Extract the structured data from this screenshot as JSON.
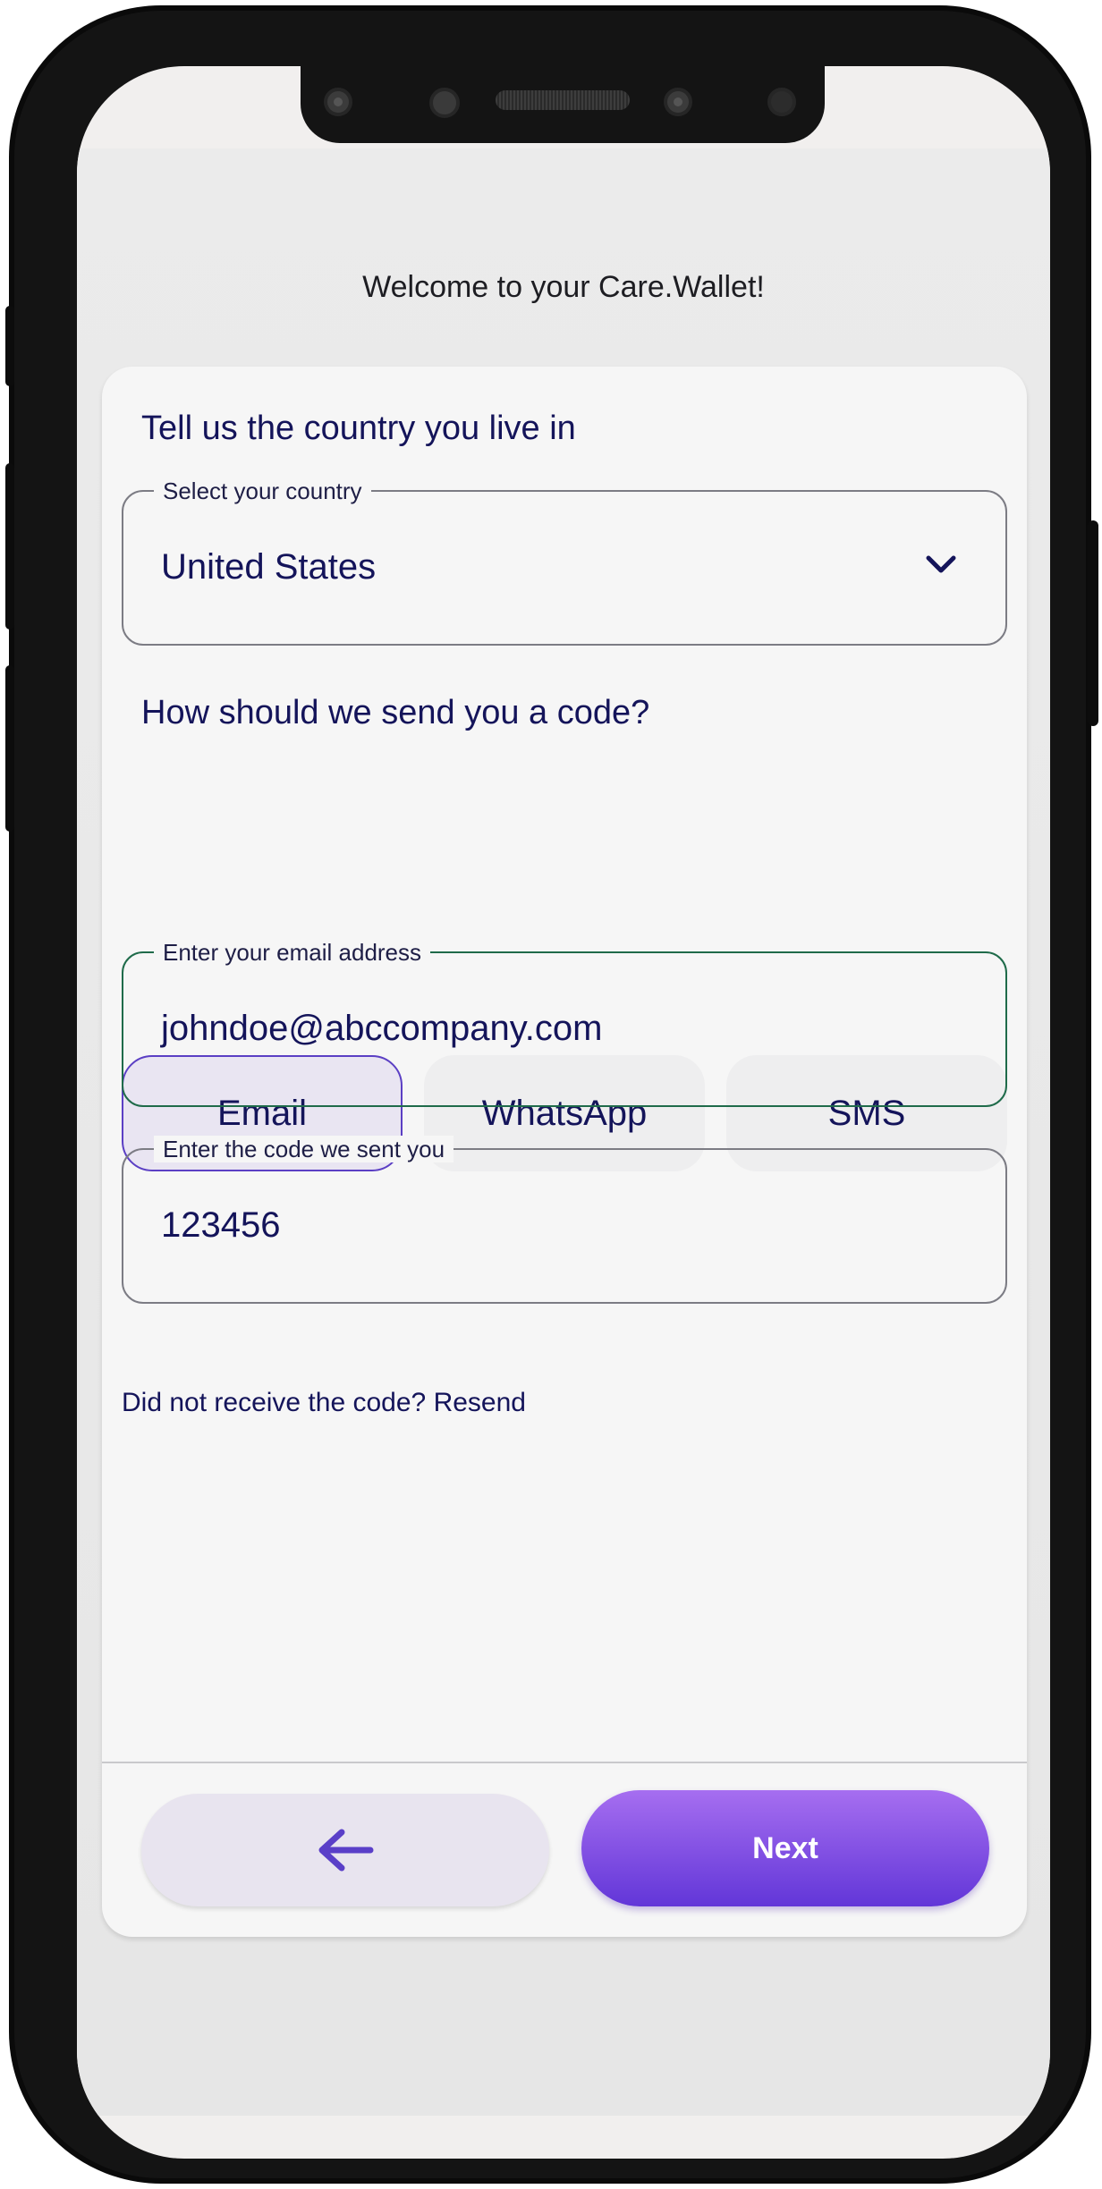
{
  "header": {
    "welcome_text": "Welcome to your Care.Wallet!"
  },
  "country_section": {
    "heading": "Tell us the country you live in",
    "select_label": "Select your country",
    "selected_value": "United States"
  },
  "code_method_section": {
    "heading": "How should we send you a code?",
    "options": [
      {
        "label": "Email",
        "selected": true
      },
      {
        "label": "WhatsApp",
        "selected": false
      },
      {
        "label": "SMS",
        "selected": false
      }
    ]
  },
  "email_field": {
    "label": "Enter your email address",
    "value": "johndoe@abccompany.com"
  },
  "code_field": {
    "label": "Enter the code we sent you",
    "value": "123456"
  },
  "resend": {
    "prompt": "Did not receive the code?",
    "link": "Resend"
  },
  "footer": {
    "back_icon": "arrow-left-icon",
    "next_label": "Next"
  },
  "colors": {
    "text_primary": "#14145a",
    "accent_purple": "#6236d8",
    "accent_purple_light": "#a66ef0",
    "selected_border": "#5b3fc4",
    "focus_border": "#1f6b4a"
  }
}
